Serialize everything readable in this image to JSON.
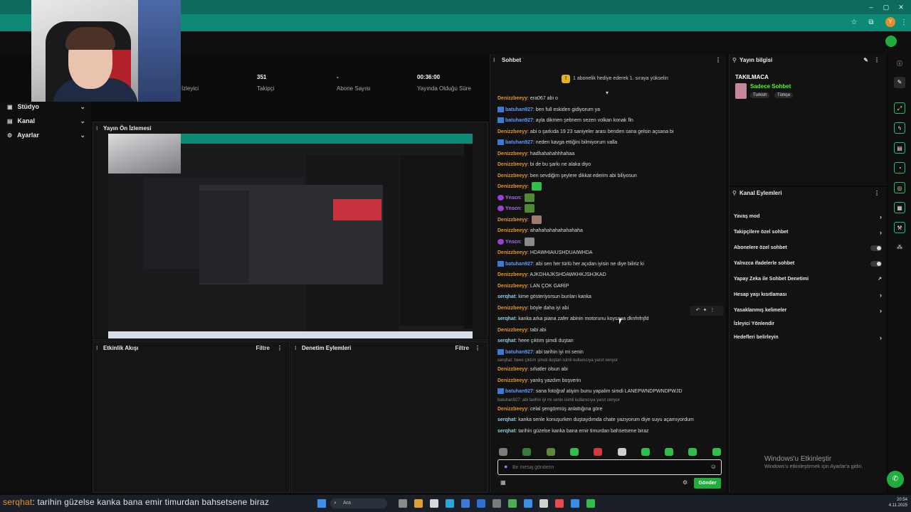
{
  "browser": {
    "avatar_letter": "Y"
  },
  "sidebar": {
    "items": [
      {
        "label": "Stüdyo",
        "icon": "studio-icon"
      },
      {
        "label": "Kanal",
        "icon": "channel-icon"
      },
      {
        "label": "Ayarlar",
        "icon": "settings-icon"
      }
    ]
  },
  "stats": [
    {
      "value": "",
      "label": "İzleyici"
    },
    {
      "value": "351",
      "label": "Takipçi"
    },
    {
      "value": "-",
      "label": "Abone Sayısı"
    },
    {
      "value": "00:36:00",
      "label": "Yayında Olduğu Süre"
    }
  ],
  "preview": {
    "title": "Yayın Ön İzlemesi"
  },
  "activity": {
    "title": "Etkinlik Akışı",
    "filter": "Filtre"
  },
  "moderation": {
    "title": "Denetim Eylemleri",
    "filter": "Filtre"
  },
  "chat": {
    "title": "Sohbet",
    "gift_banner": "1 abonelik hediye ederek 1. sıraya yükselin",
    "messages": [
      {
        "user": "Denizzbeeyy",
        "text": "era067 abi o",
        "color": "deniz"
      },
      {
        "user": "batuhan927",
        "text": "ben full eskiden gidiyorum ya",
        "color": "batu",
        "badge": true
      },
      {
        "user": "batuhan927",
        "text": "ayla dikmen şebnem sezen volkan konak fln",
        "color": "batu",
        "badge": true
      },
      {
        "user": "Denizzbeeyy",
        "text": "abi o şarkıda 19 23 saniyeler arası benden sana gelsin açsana bi",
        "color": "deniz"
      },
      {
        "user": "batuhan927",
        "text": "neden kavga ettiğini bilmiyorum valla",
        "color": "batu",
        "badge": true
      },
      {
        "user": "Denizzbeeyy",
        "text": "hadhahahahhhahaa",
        "color": "deniz"
      },
      {
        "user": "Denizzbeeyy",
        "text": "bi de bu şarkı ne alaka diyo",
        "color": "deniz"
      },
      {
        "user": "Denizzbeeyy",
        "text": "ben sevdiğim şeylere dikkat ederim abi biliyosun",
        "color": "deniz"
      },
      {
        "user": "Denizzbeeyy",
        "text": "",
        "color": "deniz",
        "emote": "heart"
      },
      {
        "user": "Ynscn",
        "text": "",
        "color": "ynsc",
        "emote": "pepe",
        "pbadge": true
      },
      {
        "user": "Ynscn",
        "text": "",
        "color": "ynsc",
        "emote": "pepe",
        "pbadge": true
      },
      {
        "user": "Denizzbeeyy",
        "text": "",
        "color": "deniz",
        "emote": "face"
      },
      {
        "user": "Denizzbeeyy",
        "text": "ahahahahahahahahaha",
        "color": "deniz"
      },
      {
        "user": "Ynscn",
        "text": "",
        "color": "ynsc",
        "emote": "cat",
        "pbadge": true
      },
      {
        "user": "Denizzbeeyy",
        "text": "HDAWHIAIUSHDUAIWHDA",
        "color": "deniz"
      },
      {
        "user": "batuhan927",
        "text": "abi sen her türlü her açıdan iyisin ne diye biliriz ki",
        "color": "batu",
        "badge": true
      },
      {
        "user": "Denizzbeeyy",
        "text": "AJKDHAJKSHDAWKHKJSHJKAD",
        "color": "deniz"
      },
      {
        "user": "Denizzbeeyy",
        "text": "LAN ÇOK GARİP",
        "color": "deniz"
      },
      {
        "user": "serqhat",
        "text": "kime gösteriyorsun bunları kanka",
        "color": "serq"
      },
      {
        "user": "Denizzbeeyy",
        "text": "böyle daha iyi abi",
        "color": "deniz"
      },
      {
        "user": "serqhat",
        "text": "kanka arka piana zafer abinin motorunu koysana dknfnfnjfd",
        "color": "serq"
      },
      {
        "user": "Denizzbeeyy",
        "text": "tabi abi",
        "color": "deniz"
      },
      {
        "user": "serqhat",
        "text": "heee çıktım şimdi duştan",
        "color": "serq"
      },
      {
        "user": "batuhan927",
        "text": "abi tarihin iyi mi senin",
        "color": "batu",
        "badge": true
      },
      {
        "reply": "serqhat: heee çıktım şimdi duştan isimli kullanıcıya yanıt veriyor"
      },
      {
        "user": "Denizzbeeyy",
        "text": "sıhatler olsun abi",
        "color": "deniz"
      },
      {
        "user": "Denizzbeeyy",
        "text": "yanlış yazdım boşverin",
        "color": "deniz"
      },
      {
        "user": "batuhan927",
        "text": "sana fotoğraf atiyim bunu yapalim simdi LANEPWNDPWNDPWJD",
        "color": "batu",
        "badge": true
      },
      {
        "reply": "batuhan927: abi tarihin iyi mi senin isimli kullanıcıya yanıt veriyor"
      },
      {
        "user": "Denizzbeeyy",
        "text": "celal şengörmüş anlattığına göre",
        "color": "deniz"
      },
      {
        "user": "serqhat",
        "text": "kanka senle konuşurken duştaydımda chate yazıyorum diye suyu açamıyordum",
        "color": "serq"
      },
      {
        "user": "serqhat",
        "text": "tarihin güzelse kanka bana emir timurdan bahsetsene biraz",
        "color": "serq"
      }
    ],
    "input_placeholder": "Bir mesaj gönderin",
    "send_label": "Gönder"
  },
  "stream_info": {
    "title": "Yayın bilgisi",
    "stream_title": "TAKILMACA",
    "mode": "Sadece Sohbet",
    "tags": [
      "Turkish",
      "Türkçe"
    ]
  },
  "channel_actions": {
    "title": "Kanal Eylemleri",
    "items": [
      {
        "label": "Yavaş mod",
        "kind": "chevron"
      },
      {
        "label": "Takipçilere özel sohbet",
        "kind": "chevron"
      },
      {
        "label": "Abonelere özel sohbet",
        "kind": "toggle"
      },
      {
        "label": "Yalnızca ifadelerle sohbet",
        "kind": "toggle"
      },
      {
        "label": "Yapay Zeka ile Sohbet Denetimi",
        "kind": "external"
      },
      {
        "label": "Hesap yaşı kısıtlaması",
        "kind": "chevron"
      },
      {
        "label": "Yasaklanmış kelimeler",
        "kind": "chevron"
      },
      {
        "label": "İzleyici Yönlendir",
        "kind": "none"
      },
      {
        "label": "Hedefleri belirleyin",
        "kind": "chevron"
      }
    ]
  },
  "windows_activation": {
    "title": "Windows'u Etkinleştir",
    "subtitle": "Windows'u etkinleştirmek için Ayarlar'a gidin."
  },
  "taskbar": {
    "search": "Ara",
    "time": "20:54",
    "date": "4.11.2025"
  },
  "subtitle": {
    "user": "serqhat",
    "text": ": tarihin güzelse kanka bana emir timurdan bahsetsene biraz"
  }
}
